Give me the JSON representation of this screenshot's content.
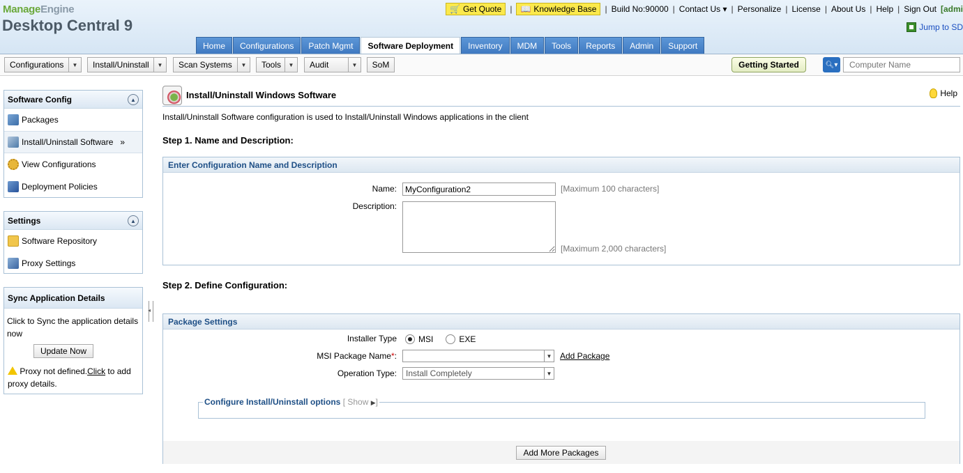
{
  "header": {
    "brand_top_a": "Manage",
    "brand_top_b": "Engine",
    "brand_main": "Desktop Central 9",
    "get_quote": "Get Quote",
    "knowledge_base": "Knowledge Base",
    "build_no": "Build No:90000",
    "contact_us": "Contact Us",
    "personalize": "Personalize",
    "license": "License",
    "about_us": "About Us",
    "help": "Help",
    "sign_out": "Sign Out",
    "user": "[admi",
    "jump_to": "Jump to SD"
  },
  "tabs": [
    {
      "label": "Home"
    },
    {
      "label": "Configurations"
    },
    {
      "label": "Patch Mgmt"
    },
    {
      "label": "Software Deployment"
    },
    {
      "label": "Inventory"
    },
    {
      "label": "MDM"
    },
    {
      "label": "Tools"
    },
    {
      "label": "Reports"
    },
    {
      "label": "Admin"
    },
    {
      "label": "Support"
    }
  ],
  "toolbar": {
    "configurations": "Configurations",
    "install_uninstall": "Install/Uninstall",
    "scan_systems": "Scan Systems",
    "tools": "Tools",
    "audit": "Audit",
    "som": "SoM",
    "getting_started": "Getting Started",
    "search_placeholder": "Computer Name"
  },
  "sidebar": {
    "software_config": {
      "title": "Software Config",
      "items": [
        "Packages",
        "Install/Uninstall Software",
        "View Configurations",
        "Deployment Policies"
      ]
    },
    "settings": {
      "title": "Settings",
      "items": [
        "Software Repository",
        "Proxy Settings"
      ]
    },
    "sync": {
      "title": "Sync Application Details",
      "text": "Click to Sync the application details now",
      "button": "Update Now",
      "proxy_text_a": "Proxy not defined.",
      "proxy_link": "Click",
      "proxy_text_b": " to add proxy details."
    }
  },
  "content": {
    "title": "Install/Uninstall Windows Software",
    "help": "Help",
    "description": "Install/Uninstall Software configuration is used to Install/Uninstall Windows applications in the client",
    "step1": "Step 1. Name and Description:",
    "box1_title": "Enter Configuration Name and Description",
    "name_label": "Name:",
    "name_value": "MyConfiguration2",
    "name_hint": "[Maximum 100 characters]",
    "desc_label": "Description:",
    "desc_hint": "[Maximum 2,000 characters]",
    "step2": "Step 2. Define Configuration:",
    "box2_title": "Package Settings",
    "installer_type_label": "Installer Type",
    "msi": "MSI",
    "exe": "EXE",
    "msi_pkg_label": "MSI Package Name",
    "required": "*",
    "colon": ":",
    "add_package": "Add Package",
    "op_type_label": "Operation Type:",
    "op_type_value": "Install Completely",
    "configure_options": "Configure Install/Uninstall options",
    "show_a": "[ Show",
    "show_b": "]",
    "add_more": "Add More Packages"
  },
  "colors": {
    "tab_active": "#ffffff",
    "tab_bg": "#4a86cc",
    "accent": "#1e4f86",
    "highlight": "#fbe94c"
  }
}
